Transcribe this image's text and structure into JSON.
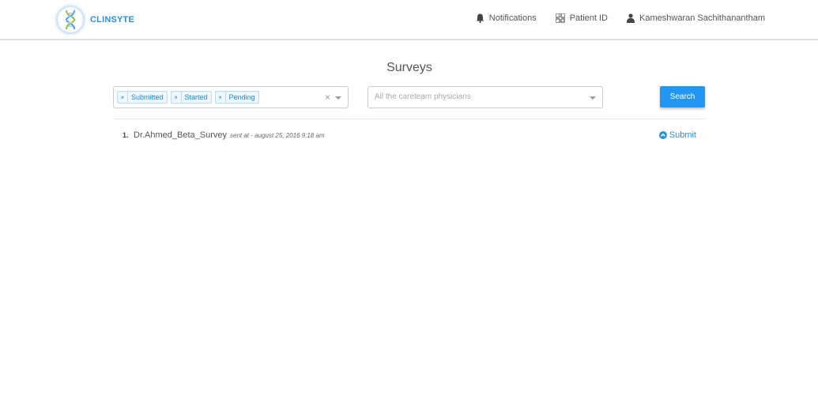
{
  "app": {
    "brand": "CLINSYTE"
  },
  "nav": {
    "notifications": "Notifications",
    "patient_id": "Patient ID",
    "user": "Kameshwaran Sachithanantham",
    "icons": {
      "notifications": "bell-icon",
      "patient_id": "qr-code-icon",
      "user": "user-icon"
    }
  },
  "page": {
    "title": "Surveys"
  },
  "filters": {
    "status_tags": [
      {
        "label": "Submitted",
        "remove": "×"
      },
      {
        "label": "Started",
        "remove": "×"
      },
      {
        "label": "Pending",
        "remove": "×"
      }
    ],
    "clear": "×",
    "physician_placeholder": "All the careteam physicians",
    "search_label": "Search"
  },
  "surveys": [
    {
      "number": "1.",
      "name": "Dr.Ahmed_Beta_Survey",
      "sent": "sent at - august 25, 2016 9:18 am",
      "action": "Submit"
    }
  ],
  "colors": {
    "accent": "#2196f3",
    "link": "#2a8fd8",
    "brand": "#2a8fd8"
  }
}
